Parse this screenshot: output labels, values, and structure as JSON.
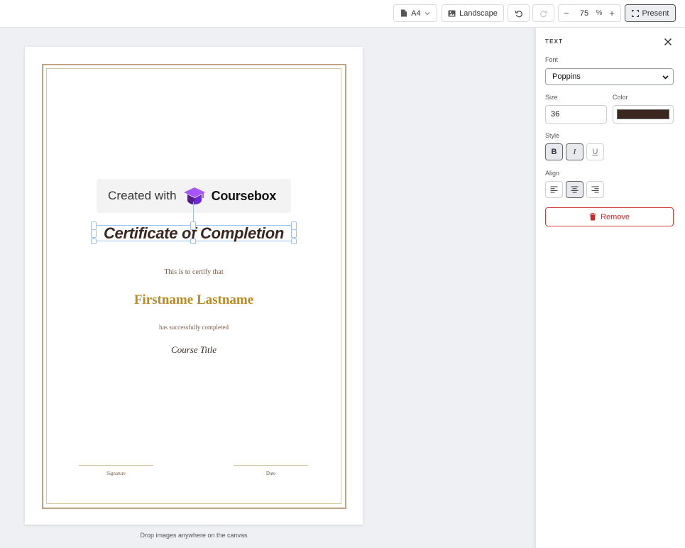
{
  "toolbar": {
    "page_size": "A4",
    "orientation": "Landscape",
    "zoom_value": "75",
    "zoom_unit": "%",
    "zoom_minus": "−",
    "zoom_plus": "+",
    "present": "Present"
  },
  "certificate": {
    "badge_text": "Created with",
    "badge_brand": "Coursebox",
    "title": "Certificate of Completion",
    "certify_text": "This is to certify that",
    "recipient": "Firstname Lastname",
    "completed_text": "has successfully completed",
    "course": "Course Title",
    "signature_label": "Signature",
    "date_label": "Date"
  },
  "canvas_hint": "Drop images anywhere on the canvas",
  "panel": {
    "title": "TEXT",
    "font_label": "Font",
    "font_value": "Poppins",
    "size_label": "Size",
    "size_value": "36",
    "color_label": "Color",
    "color_value": "#3b2620",
    "style_label": "Style",
    "bold": "B",
    "italic": "I",
    "underline": "U",
    "align_label": "Align",
    "remove": "Remove"
  },
  "colors": {
    "accent_gold": "#b98b22",
    "frame": "#bfa57f",
    "danger": "#d33a3a",
    "selection": "#9ec1f0"
  }
}
